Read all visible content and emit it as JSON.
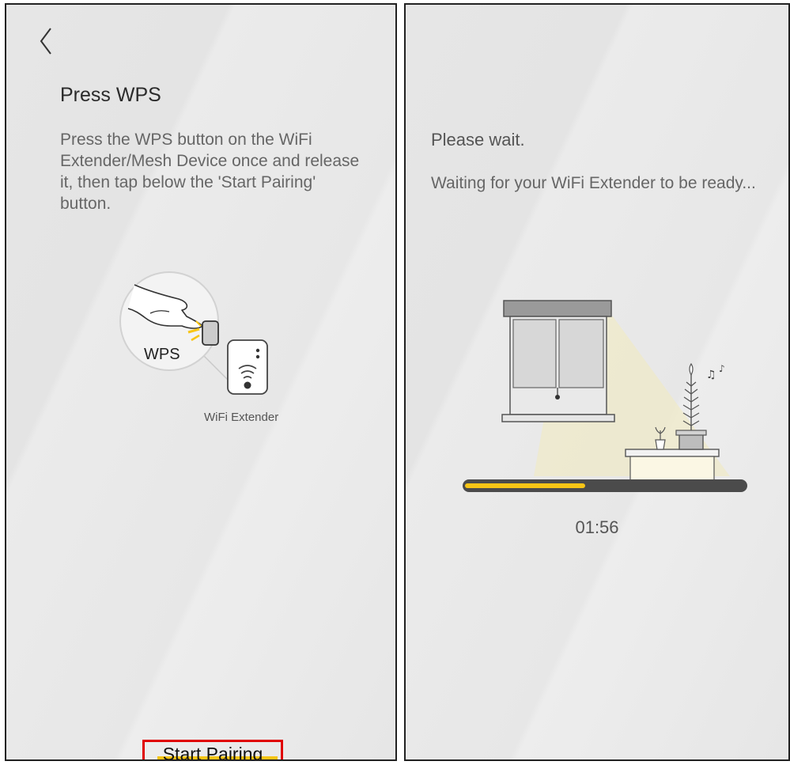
{
  "pair_screen": {
    "title": "Press WPS",
    "description": "Press the WPS button on the WiFi Extender/Mesh Device once and release it, then tap below the 'Start Pairing' button.",
    "illustration": {
      "wps_label": "WPS",
      "device_label": "WiFi Extender"
    },
    "start_button_label": "Start Pairing",
    "icons": {
      "back": "chevron-left-icon"
    }
  },
  "wait_screen": {
    "title": "Please wait.",
    "description": "Waiting for your WiFi Extender to be ready...",
    "progress": 0.43,
    "timer": "01:56"
  },
  "colors": {
    "accent": "#f7c516",
    "highlight_border": "#e00000",
    "progress_track": "#4b4b4b"
  }
}
